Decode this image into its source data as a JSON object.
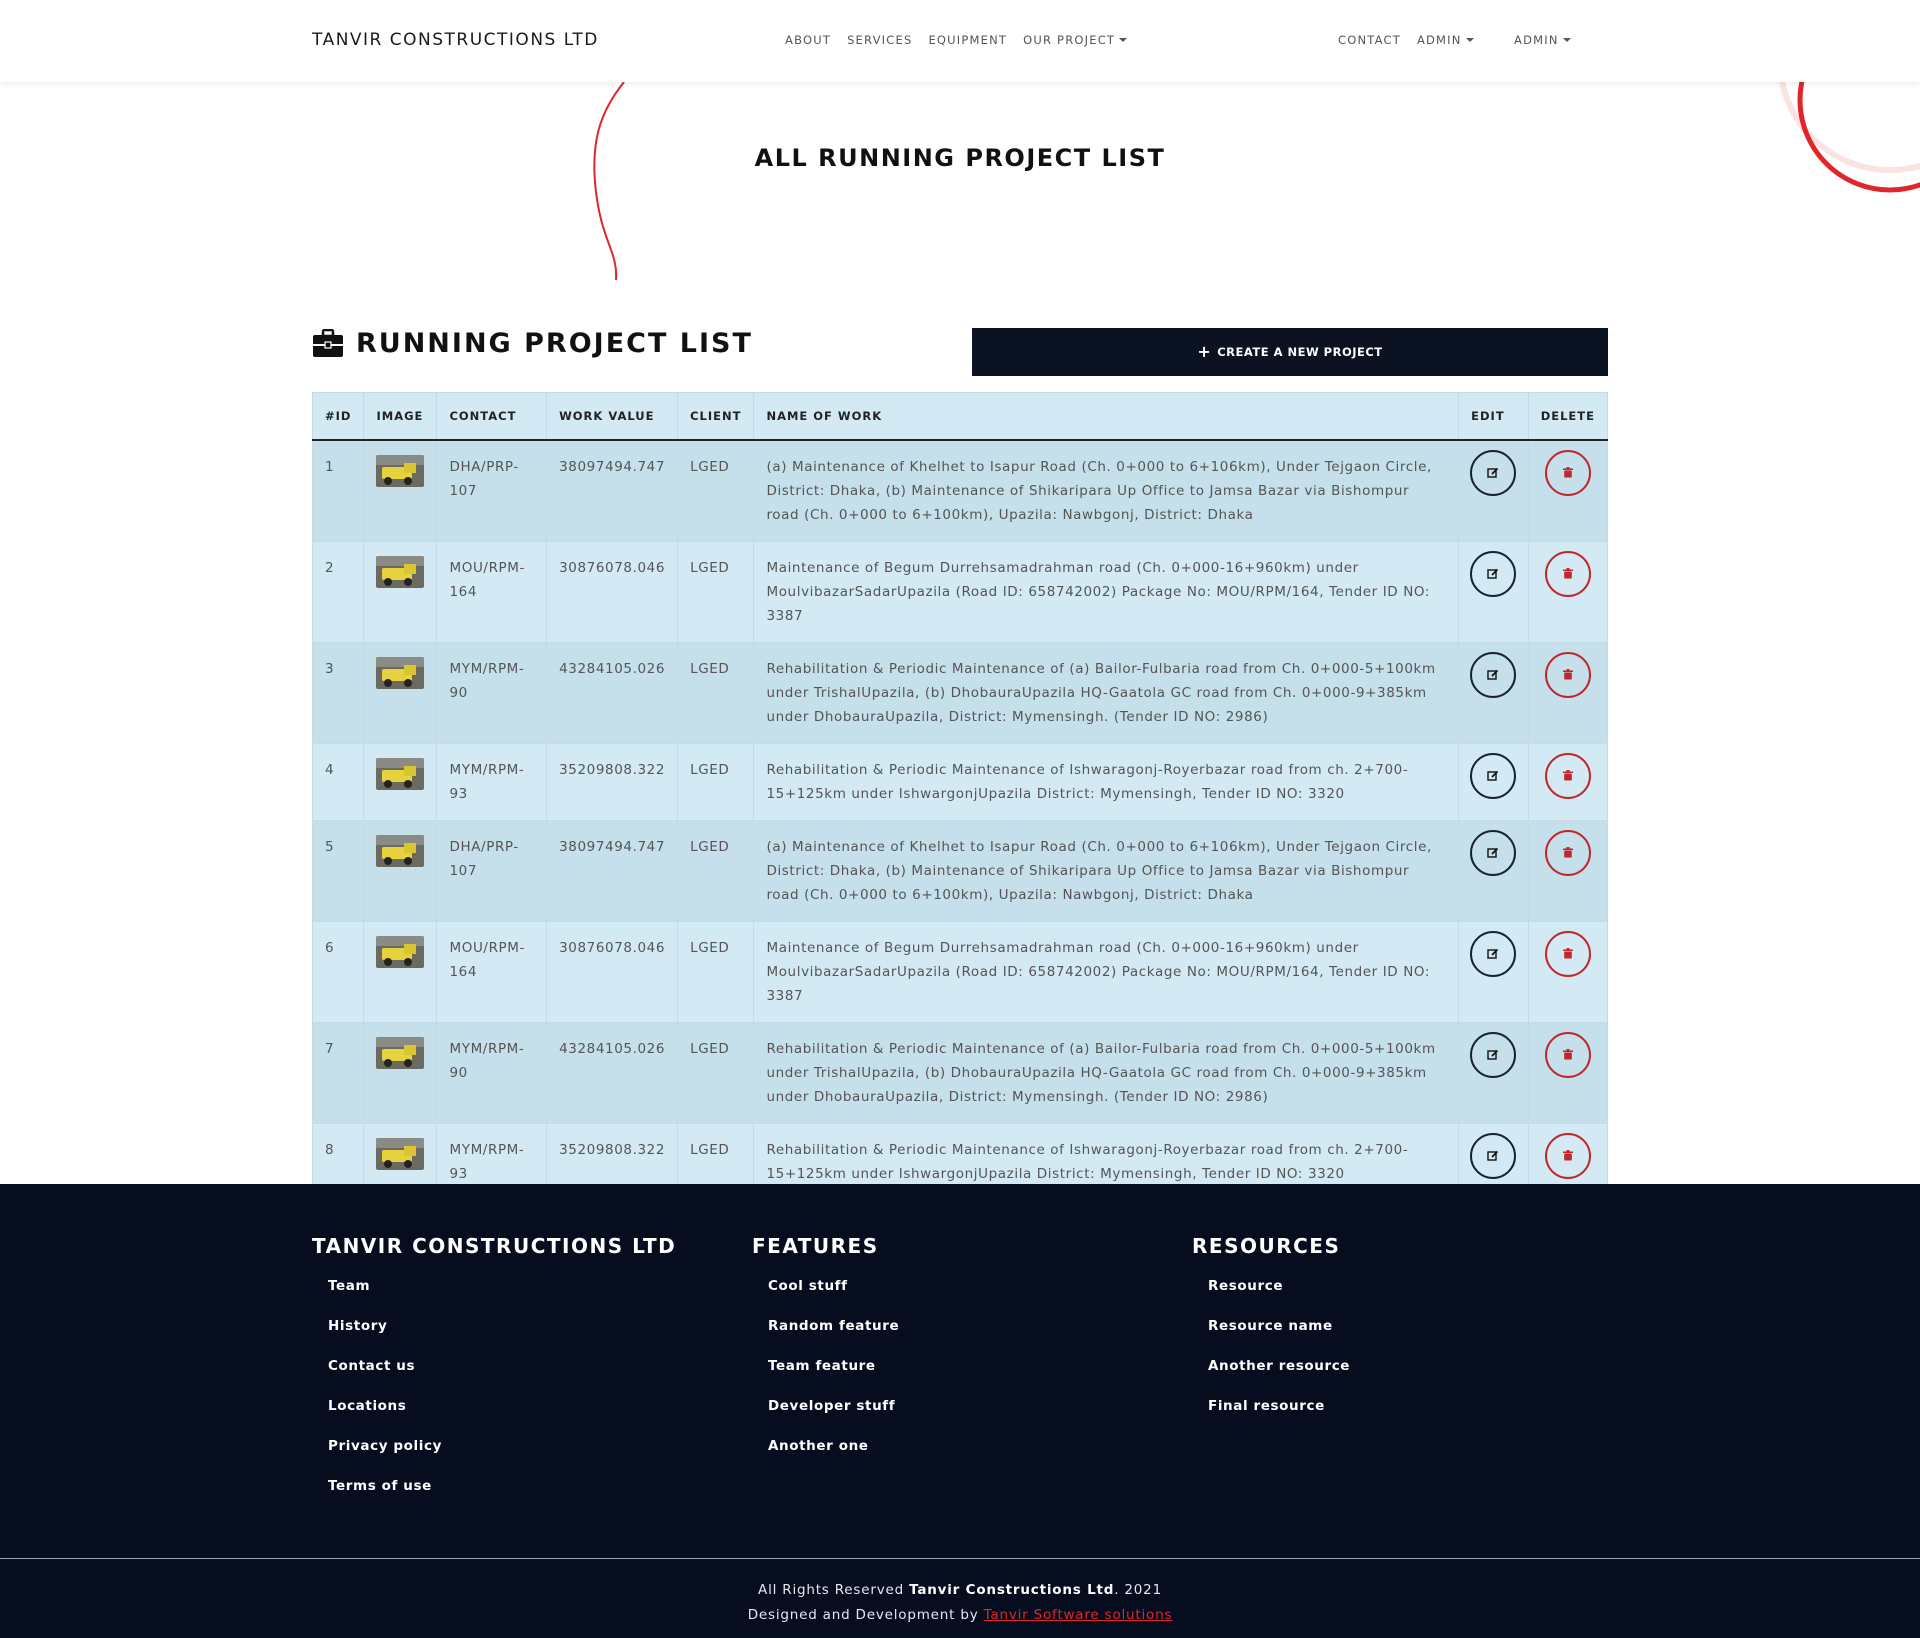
{
  "navbar": {
    "brand": "TANVIR CONSTRUCTIONS LTD",
    "center_items": [
      "ABOUT",
      "SERVICES",
      "EQUIPMENT",
      "OUR PROJECT"
    ],
    "contact": "CONTACT",
    "admin_1": "ADMIN",
    "admin_2": "ADMIN"
  },
  "hero": {
    "title": "ALL RUNNING PROJECT LIST"
  },
  "section": {
    "title": "RUNNING PROJECT LIST",
    "create_button": "CREATE A NEW PROJECT"
  },
  "table": {
    "headers": [
      "#ID",
      "IMAGE",
      "CONTACT",
      "WORK VALUE",
      "CLIENT",
      "NAME OF WORK",
      "EDIT",
      "DELETE"
    ],
    "rows": [
      {
        "id": "1",
        "contact": "DHA/PRP-107",
        "value": "38097494.747",
        "client": "LGED",
        "name": "(a) Maintenance of Khelhet to Isapur Road (Ch. 0+000 to 6+106km), Under Tejgaon Circle, District: Dhaka, (b) Maintenance of Shikaripara Up Office to Jamsa Bazar via Bishompur road (Ch. 0+000 to 6+100km), Upazila: Nawbgonj, District: Dhaka"
      },
      {
        "id": "2",
        "contact": "MOU/RPM-164",
        "value": "30876078.046",
        "client": "LGED",
        "name": "Maintenance of Begum Durrehsamadrahman road (Ch. 0+000-16+960km) under MoulvibazarSadarUpazila (Road ID: 658742002) Package No: MOU/RPM/164, Tender ID NO: 3387"
      },
      {
        "id": "3",
        "contact": "MYM/RPM-90",
        "value": "43284105.026",
        "client": "LGED",
        "name": "Rehabilitation & Periodic Maintenance of (a) Bailor-Fulbaria road from Ch. 0+000-5+100km under TrishalUpazila, (b) DhobauraUpazila HQ-Gaatola GC road from Ch. 0+000-9+385km under DhobauraUpazila, District: Mymensingh. (Tender ID NO: 2986)"
      },
      {
        "id": "4",
        "contact": "MYM/RPM-93",
        "value": "35209808.322",
        "client": "LGED",
        "name": "Rehabilitation & Periodic Maintenance of Ishwaragonj-Royerbazar road from ch. 2+700-15+125km under IshwargonjUpazila District: Mymensingh, Tender ID NO: 3320"
      },
      {
        "id": "5",
        "contact": "DHA/PRP-107",
        "value": "38097494.747",
        "client": "LGED",
        "name": "(a) Maintenance of Khelhet to Isapur Road (Ch. 0+000 to 6+106km), Under Tejgaon Circle, District: Dhaka, (b) Maintenance of Shikaripara Up Office to Jamsa Bazar via Bishompur road (Ch. 0+000 to 6+100km), Upazila: Nawbgonj, District: Dhaka"
      },
      {
        "id": "6",
        "contact": "MOU/RPM-164",
        "value": "30876078.046",
        "client": "LGED",
        "name": "Maintenance of Begum Durrehsamadrahman road (Ch. 0+000-16+960km) under MoulvibazarSadarUpazila (Road ID: 658742002) Package No: MOU/RPM/164, Tender ID NO: 3387"
      },
      {
        "id": "7",
        "contact": "MYM/RPM-90",
        "value": "43284105.026",
        "client": "LGED",
        "name": "Rehabilitation & Periodic Maintenance of (a) Bailor-Fulbaria road from Ch. 0+000-5+100km under TrishalUpazila, (b) DhobauraUpazila HQ-Gaatola GC road from Ch. 0+000-9+385km under DhobauraUpazila, District: Mymensingh. (Tender ID NO: 2986)"
      },
      {
        "id": "8",
        "contact": "MYM/RPM-93",
        "value": "35209808.322",
        "client": "LGED",
        "name": "Rehabilitation & Periodic Maintenance of Ishwaragonj-Royerbazar road from ch. 2+700-15+125km under IshwargonjUpazila District: Mymensingh, Tender ID NO: 3320"
      }
    ]
  },
  "footer": {
    "col1": {
      "title": "TANVIR CONSTRUCTIONS LTD",
      "links": [
        "Team",
        "History",
        "Contact us",
        "Locations",
        "Privacy policy",
        "Terms of use"
      ]
    },
    "col2": {
      "title": "FEATURES",
      "links": [
        "Cool stuff",
        "Random feature",
        "Team feature",
        "Developer stuff",
        "Another one"
      ]
    },
    "col3": {
      "title": "RESOURCES",
      "links": [
        "Resource",
        "Resource name",
        "Another resource",
        "Final resource"
      ]
    },
    "rights_prefix": "All Rights Reserved",
    "rights_company": "Tanvir Constructions Ltd",
    "rights_year": ". 2021",
    "designed_prefix": "Designed and Development by",
    "designed_link": "Tanvir Software solutions"
  },
  "colors": {
    "accent_red": "#e0262c",
    "navy": "#0b1222",
    "table_light": "#d3eaf5",
    "table_dark": "#c5dfeb"
  }
}
